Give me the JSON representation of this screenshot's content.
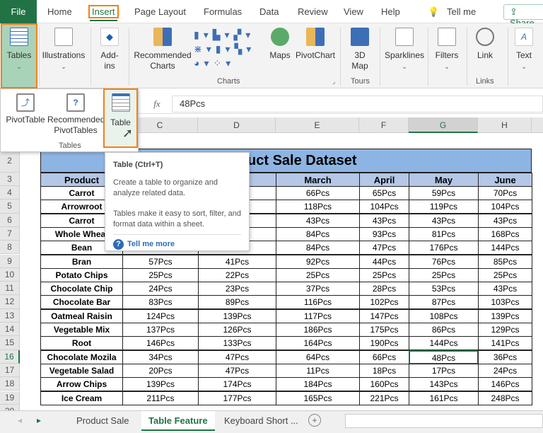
{
  "ribbon_tabs": [
    "File",
    "Home",
    "Insert",
    "Page Layout",
    "Formulas",
    "Data",
    "Review",
    "View",
    "Help",
    "Tell me",
    "Share"
  ],
  "ribbon": {
    "tables": "Tables",
    "illustrations": "Illustrations",
    "addins": "Add-ins",
    "rec_charts": "Recommended Charts",
    "maps": "Maps",
    "pivotchart": "PivotChart",
    "map3d": "3D Map",
    "sparklines": "Sparklines",
    "filters": "Filters",
    "link": "Link",
    "text": "Text",
    "groups": {
      "charts": "Charts",
      "tours": "Tours",
      "links": "Links"
    }
  },
  "dropdown": {
    "pivottable": "PivotTable",
    "rec_pivot": "Recommended PivotTables",
    "table": "Table",
    "group": "Tables"
  },
  "tooltip": {
    "title": "Table (Ctrl+T)",
    "line1": "Create a table to organize and analyze related data.",
    "line2": "Tables make it easy to sort, filter, and format data within a sheet.",
    "link": "Tell me more"
  },
  "formula_bar": {
    "fx": "fx",
    "value": "48Pcs"
  },
  "columns": [
    "C",
    "D",
    "E",
    "F",
    "G",
    "H"
  ],
  "rows": [
    "2",
    "3",
    "4",
    "5",
    "6",
    "7",
    "8",
    "9",
    "10",
    "11",
    "12",
    "13",
    "14",
    "15",
    "16",
    "17",
    "18",
    "19",
    "20"
  ],
  "sheet": {
    "title": "Product Sale Dataset",
    "headers": [
      "Product",
      "",
      "",
      "March",
      "April",
      "May",
      "June"
    ],
    "data": [
      [
        "Carrot",
        "",
        "",
        "66Pcs",
        "65Pcs",
        "59Pcs",
        "70Pcs"
      ],
      [
        "Arrowroot",
        "",
        "",
        "118Pcs",
        "104Pcs",
        "119Pcs",
        "104Pcs"
      ],
      [
        "Carrot",
        "",
        "",
        "43Pcs",
        "43Pcs",
        "43Pcs",
        "43Pcs"
      ],
      [
        "Whole Wheat",
        "",
        "",
        "84Pcs",
        "93Pcs",
        "81Pcs",
        "168Pcs"
      ],
      [
        "Bean",
        "",
        "",
        "84Pcs",
        "47Pcs",
        "176Pcs",
        "144Pcs"
      ],
      [
        "Bran",
        "57Pcs",
        "41Pcs",
        "92Pcs",
        "44Pcs",
        "76Pcs",
        "85Pcs"
      ],
      [
        "Potato Chips",
        "25Pcs",
        "22Pcs",
        "25Pcs",
        "25Pcs",
        "25Pcs",
        "25Pcs"
      ],
      [
        "Chocolate Chip",
        "24Pcs",
        "23Pcs",
        "37Pcs",
        "28Pcs",
        "53Pcs",
        "43Pcs"
      ],
      [
        "Chocolate Bar",
        "83Pcs",
        "89Pcs",
        "116Pcs",
        "102Pcs",
        "87Pcs",
        "103Pcs"
      ],
      [
        "Oatmeal Raisin",
        "124Pcs",
        "139Pcs",
        "117Pcs",
        "147Pcs",
        "108Pcs",
        "139Pcs"
      ],
      [
        "Vegetable Mix",
        "137Pcs",
        "126Pcs",
        "186Pcs",
        "175Pcs",
        "86Pcs",
        "129Pcs"
      ],
      [
        "Root",
        "146Pcs",
        "133Pcs",
        "164Pcs",
        "190Pcs",
        "144Pcs",
        "141Pcs"
      ],
      [
        "Chocolate Mozila",
        "34Pcs",
        "47Pcs",
        "64Pcs",
        "66Pcs",
        "48Pcs",
        "36Pcs"
      ],
      [
        "Vegetable Salad",
        "20Pcs",
        "47Pcs",
        "11Pcs",
        "18Pcs",
        "17Pcs",
        "24Pcs"
      ],
      [
        "Arrow Chips",
        "139Pcs",
        "174Pcs",
        "184Pcs",
        "160Pcs",
        "143Pcs",
        "146Pcs"
      ],
      [
        "Ice Cream",
        "211Pcs",
        "177Pcs",
        "165Pcs",
        "221Pcs",
        "161Pcs",
        "248Pcs"
      ]
    ]
  },
  "sheet_tabs": [
    "Product Sale",
    "Table Feature",
    "Keyboard Short ..."
  ],
  "active_sheet": "Table Feature",
  "colors": {
    "accent": "#217346",
    "highlight": "#f57f17",
    "title_fill": "#8eb4e3",
    "header_fill": "#b4c7e7"
  }
}
